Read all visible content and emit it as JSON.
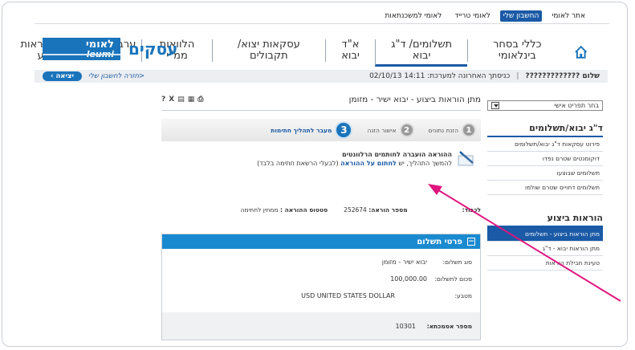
{
  "toplinks": [
    "אתר לאומי",
    "החשבון שלי",
    "לאומי טרייד",
    "לאומי למשכנתאות"
  ],
  "toplinks_active_index": 1,
  "nav": [
    "כללי בסחר בינלאומי",
    "תשלומים/ ד\"ג יבוא",
    "א\"ד יבוא",
    "עסקאות יצוא/ תקבולים",
    "הלוואות ממ\"י",
    "ערבויות",
    "ניהול הוראות ביצוע"
  ],
  "nav_active_index": 1,
  "logo": {
    "he": "לאומי",
    "en": "leumi",
    "brand": "עסקים"
  },
  "status": {
    "greeting": "שלום ?????????????",
    "separator": "|",
    "last_login": "כניסתך האחרונה למערכת: 14:11 02/10/13",
    "back_link": "<חזרה לחשבון שלי",
    "exit": "יציאה ›"
  },
  "sidebar": {
    "select_value": "בחר תפריט אישי",
    "section1_title": "ד\"ג יבוא/תשלומים",
    "section1_items": [
      "פירוט עסקאות ד\"ג יבוא/תשלומים",
      "דוקומנטים שטרם נפדו",
      "תשלומים שבוצעו",
      "תשלומים דחויים שטרם שולמו"
    ],
    "section2_title": "הוראות ביצוע",
    "section2_items": [
      "מתן הוראות ביצוע - תשלומים",
      "מתן הוראות יבוא - ד\"ג",
      "טעינת חבילת הוראות"
    ],
    "section2_active_index": 0
  },
  "main": {
    "title": "מתן הוראות ביצוע - יבוא ישיר - מזומן",
    "tools": [
      "?",
      "X",
      "▤",
      "▦",
      "⎙"
    ],
    "steps": [
      {
        "num": "1",
        "label": "הזנת נתונים"
      },
      {
        "num": "2",
        "label": "אישור הזנה"
      },
      {
        "num": "3",
        "label": "מעבר לתהליך חתימות"
      }
    ],
    "active_step_index": 2,
    "notice_line1": "ההוראה הועברה לחותמים הרלוונטים",
    "notice_line2_prefix": "להמשך התהליך, יש ",
    "notice_line2_link": "לחתום על ההוראה",
    "notice_line2_suffix": " (לבעלי הרשאת חתימה בלבד)",
    "info": {
      "for_label": "לכבוד:",
      "order_label": "מספר הוראה:",
      "order_value": "252674",
      "status_label": "סטטוס ההוראה :",
      "status_value": "ממתין לחתימה"
    },
    "panel": {
      "title": "פרטי תשלום",
      "toggle": "−",
      "rows": [
        {
          "k": "סוג תשלום:",
          "v": "יבוא ישיר - מזומן"
        },
        {
          "k": "סכום לתשלום:",
          "v": "100,000.00"
        },
        {
          "k": "מטבע:",
          "v": "USD UNITED STATES DOLLAR"
        }
      ],
      "customer_label": "מספר אסמכתא:",
      "customer_value": "10301"
    }
  },
  "colors": {
    "primary": "#1a5aa6",
    "logo": "#1a74bb",
    "panel_head": "#1a8ad0",
    "arrow": "#e0167f"
  }
}
